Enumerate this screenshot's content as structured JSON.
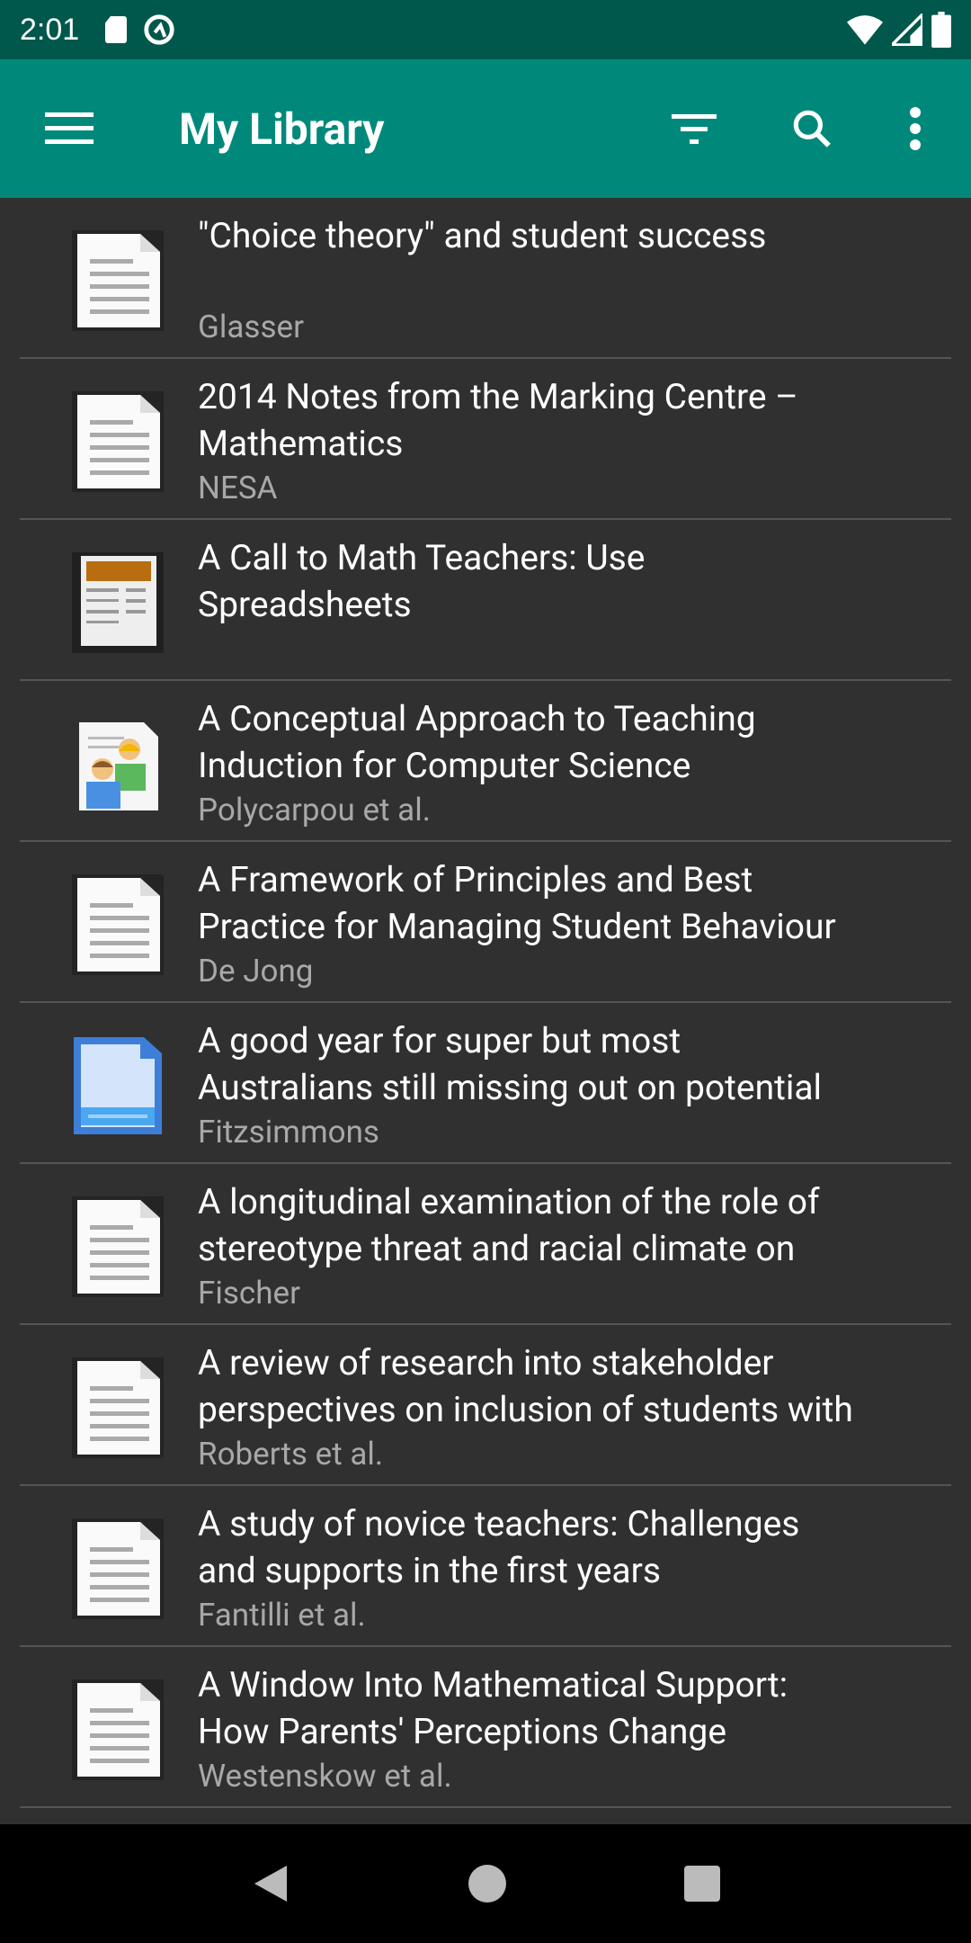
{
  "status_bar": {
    "time": "2:01",
    "icons": [
      "sd-card-icon",
      "q-logo-icon",
      "wifi-icon",
      "signal-icon",
      "battery-icon"
    ]
  },
  "toolbar": {
    "title": "My Library",
    "icons": [
      "menu-icon",
      "filter-icon",
      "search-icon",
      "more-vert-icon"
    ],
    "color": "#00897b"
  },
  "items": [
    {
      "title_lines": [
        "\"Choice theory\" and student success"
      ],
      "author": "Glasser",
      "icon": "document-icon"
    },
    {
      "title_lines": [
        "2014 Notes from the Marking Centre –",
        "Mathematics"
      ],
      "author": "NESA",
      "icon": "document-icon"
    },
    {
      "title_lines": [
        "A Call to Math Teachers: Use",
        "Spreadsheets"
      ],
      "author": "",
      "icon": "spreadsheet-icon"
    },
    {
      "title_lines": [
        "A Conceptual Approach to Teaching",
        "Induction for Computer Science"
      ],
      "author": "Polycarpou et al.",
      "icon": "presentation-icon"
    },
    {
      "title_lines": [
        "A Framework of Principles and Best",
        "Practice for Managing Student Behaviour"
      ],
      "author": "De Jong",
      "icon": "document-icon"
    },
    {
      "title_lines": [
        "A good year for super but most",
        "Australians still missing out on potential"
      ],
      "author": "Fitzsimmons",
      "icon": "web-page-icon"
    },
    {
      "title_lines": [
        "A longitudinal examination of the role of",
        "stereotype threat and racial climate on"
      ],
      "author": "Fischer",
      "icon": "document-icon"
    },
    {
      "title_lines": [
        "A review of research into stakeholder",
        "perspectives on inclusion of students with"
      ],
      "author": "Roberts et al.",
      "icon": "document-icon"
    },
    {
      "title_lines": [
        "A study of novice teachers: Challenges",
        "and supports in the first years"
      ],
      "author": "Fantilli et al.",
      "icon": "document-icon"
    },
    {
      "title_lines": [
        "A Window Into Mathematical Support:",
        "How Parents' Perceptions Change"
      ],
      "author": "Westenskow et al.",
      "icon": "document-icon"
    }
  ],
  "nav": [
    "back-icon",
    "home-icon",
    "recents-icon"
  ]
}
